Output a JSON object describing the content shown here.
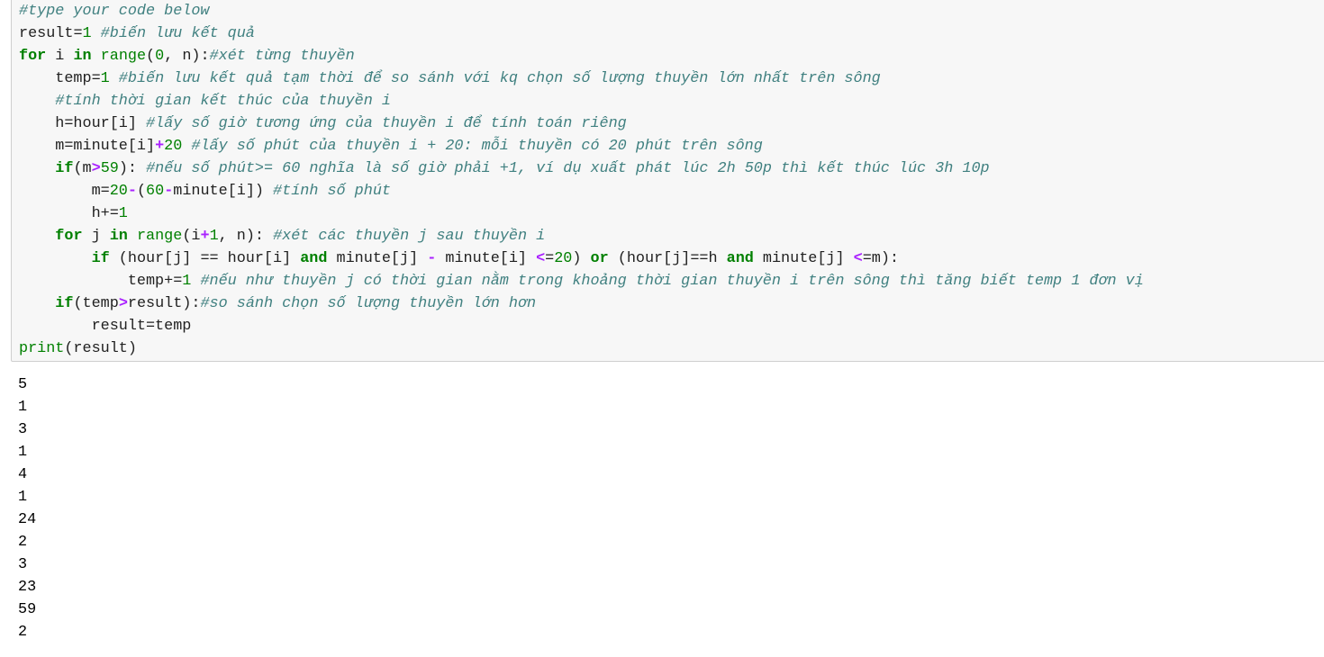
{
  "code_cell": {
    "lines": [
      [
        {
          "t": "cm",
          "v": "#type your code below"
        }
      ],
      [
        {
          "t": "tx",
          "v": "result"
        },
        {
          "t": "tx",
          "v": "="
        },
        {
          "t": "num",
          "v": "1"
        },
        {
          "t": "tx",
          "v": " "
        },
        {
          "t": "cm",
          "v": "#biến lưu kết quả"
        }
      ],
      [
        {
          "t": "kw",
          "v": "for"
        },
        {
          "t": "tx",
          "v": " i "
        },
        {
          "t": "kw",
          "v": "in"
        },
        {
          "t": "tx",
          "v": " "
        },
        {
          "t": "bi",
          "v": "range"
        },
        {
          "t": "tx",
          "v": "("
        },
        {
          "t": "num",
          "v": "0"
        },
        {
          "t": "tx",
          "v": ", n):"
        },
        {
          "t": "cm",
          "v": "#xét từng thuyền"
        }
      ],
      [
        {
          "t": "tx",
          "v": "    temp="
        },
        {
          "t": "num",
          "v": "1"
        },
        {
          "t": "tx",
          "v": " "
        },
        {
          "t": "cm",
          "v": "#biến lưu kết quả tạm thời để so sánh với kq chọn số lượng thuyền lớn nhất trên sông"
        }
      ],
      [
        {
          "t": "tx",
          "v": "    "
        },
        {
          "t": "cm",
          "v": "#tính thời gian kết thúc của thuyền i"
        }
      ],
      [
        {
          "t": "tx",
          "v": "    h=hour[i] "
        },
        {
          "t": "cm",
          "v": "#lấy số giờ tương ứng của thuyền i để tính toán riêng"
        }
      ],
      [
        {
          "t": "tx",
          "v": "    m=minute[i]"
        },
        {
          "t": "op",
          "v": "+"
        },
        {
          "t": "num",
          "v": "20"
        },
        {
          "t": "tx",
          "v": " "
        },
        {
          "t": "cm",
          "v": "#lấy số phút của thuyền i + 20: mỗi thuyền có 20 phút trên sông"
        }
      ],
      [
        {
          "t": "tx",
          "v": "    "
        },
        {
          "t": "kw",
          "v": "if"
        },
        {
          "t": "tx",
          "v": "(m"
        },
        {
          "t": "op",
          "v": ">"
        },
        {
          "t": "num",
          "v": "59"
        },
        {
          "t": "tx",
          "v": "): "
        },
        {
          "t": "cm",
          "v": "#nếu số phút>= 60 nghĩa là số giờ phải +1, ví dụ xuất phát lúc 2h 50p thì kết thúc lúc 3h 10p"
        }
      ],
      [
        {
          "t": "tx",
          "v": "        m="
        },
        {
          "t": "num",
          "v": "20"
        },
        {
          "t": "op",
          "v": "-"
        },
        {
          "t": "tx",
          "v": "("
        },
        {
          "t": "num",
          "v": "60"
        },
        {
          "t": "op",
          "v": "-"
        },
        {
          "t": "tx",
          "v": "minute[i]) "
        },
        {
          "t": "cm",
          "v": "#tính số phút"
        }
      ],
      [
        {
          "t": "tx",
          "v": "        h+="
        },
        {
          "t": "num",
          "v": "1"
        }
      ],
      [
        {
          "t": "tx",
          "v": "    "
        },
        {
          "t": "kw",
          "v": "for"
        },
        {
          "t": "tx",
          "v": " j "
        },
        {
          "t": "kw",
          "v": "in"
        },
        {
          "t": "tx",
          "v": " "
        },
        {
          "t": "bi",
          "v": "range"
        },
        {
          "t": "tx",
          "v": "(i"
        },
        {
          "t": "op",
          "v": "+"
        },
        {
          "t": "num",
          "v": "1"
        },
        {
          "t": "tx",
          "v": ", n): "
        },
        {
          "t": "cm",
          "v": "#xét các thuyền j sau thuyền i"
        }
      ],
      [
        {
          "t": "tx",
          "v": "        "
        },
        {
          "t": "kw",
          "v": "if"
        },
        {
          "t": "tx",
          "v": " (hour[j] == hour[i] "
        },
        {
          "t": "kw",
          "v": "and"
        },
        {
          "t": "tx",
          "v": " minute[j] "
        },
        {
          "t": "op",
          "v": "-"
        },
        {
          "t": "tx",
          "v": " minute[i] "
        },
        {
          "t": "op",
          "v": "<"
        },
        {
          "t": "tx",
          "v": "="
        },
        {
          "t": "num",
          "v": "20"
        },
        {
          "t": "tx",
          "v": ") "
        },
        {
          "t": "kw",
          "v": "or"
        },
        {
          "t": "tx",
          "v": " (hour[j]==h "
        },
        {
          "t": "kw",
          "v": "and"
        },
        {
          "t": "tx",
          "v": " minute[j] "
        },
        {
          "t": "op",
          "v": "<"
        },
        {
          "t": "tx",
          "v": "=m):"
        }
      ],
      [
        {
          "t": "tx",
          "v": "            temp+="
        },
        {
          "t": "num",
          "v": "1"
        },
        {
          "t": "tx",
          "v": " "
        },
        {
          "t": "cm",
          "v": "#nếu như thuyền j có thời gian nằm trong khoảng thời gian thuyền i trên sông thì tăng biết temp 1 đơn vị"
        }
      ],
      [
        {
          "t": "tx",
          "v": "    "
        },
        {
          "t": "kw",
          "v": "if"
        },
        {
          "t": "tx",
          "v": "(temp"
        },
        {
          "t": "op",
          "v": ">"
        },
        {
          "t": "tx",
          "v": "result):"
        },
        {
          "t": "cm",
          "v": "#so sánh chọn số lượng thuyền lớn hơn"
        }
      ],
      [
        {
          "t": "tx",
          "v": "        result=temp"
        }
      ],
      [
        {
          "t": "bi",
          "v": "print"
        },
        {
          "t": "tx",
          "v": "(result)"
        }
      ]
    ]
  },
  "output_cell": {
    "lines": [
      "5",
      "1",
      "3",
      "1",
      "4",
      "1",
      "24",
      "2",
      "3",
      "23",
      "59",
      "2"
    ]
  },
  "colors": {
    "keyword": "#008000",
    "number": "#008000",
    "operator": "#aa22ff",
    "comment": "#408080",
    "text": "#212121",
    "cell_background": "#f7f7f7"
  }
}
